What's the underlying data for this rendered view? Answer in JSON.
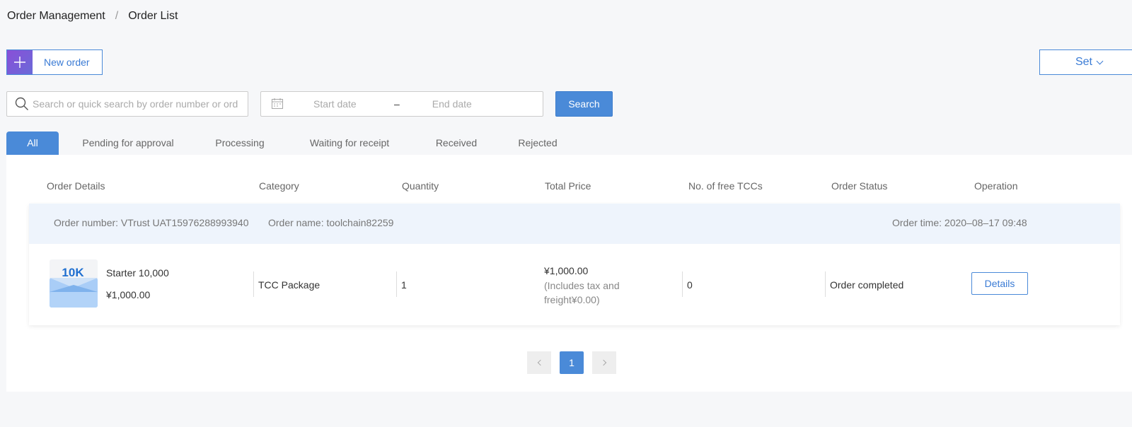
{
  "breadcrumb": {
    "items": [
      "Order Management",
      "Order List"
    ],
    "separator": "/"
  },
  "toolbar": {
    "new_order_label": "New order",
    "set_label": "Set"
  },
  "search": {
    "placeholder": "Search or quick search by order number or order name"
  },
  "date_range": {
    "start_placeholder": "Start date",
    "separator": "–",
    "end_placeholder": "End date"
  },
  "search_button_label": "Search",
  "tabs": [
    {
      "label": "All",
      "active": true
    },
    {
      "label": "Pending for approval"
    },
    {
      "label": "Processing"
    },
    {
      "label": "Waiting for receipt"
    },
    {
      "label": "Received"
    },
    {
      "label": "Rejected"
    }
  ],
  "table": {
    "columns": [
      "Order Details",
      "Category",
      "Quantity",
      "Total Price",
      "No. of free TCCs",
      "Order Status",
      "Operation"
    ]
  },
  "order": {
    "number_label": "Order number: VTrust UAT15976288993940",
    "name_label": "Order name: toolchain82259",
    "time_label": "Order time: 2020–08–17 09:48",
    "thumb_text": "10K",
    "product_name": "Starter 10,000",
    "product_price": "¥1,000.00",
    "category": "TCC Package",
    "quantity": "1",
    "total_price": "¥1,000.00",
    "price_note": "(Includes tax and freight¥0.00)",
    "free_tccs": "0",
    "status": "Order completed",
    "operation_label": "Details"
  },
  "pagination": {
    "current_page": "1"
  },
  "colors": {
    "accent": "#4a8ad8",
    "row_header_bg": "#eef4fc",
    "page_bg": "#f6f7f9"
  }
}
